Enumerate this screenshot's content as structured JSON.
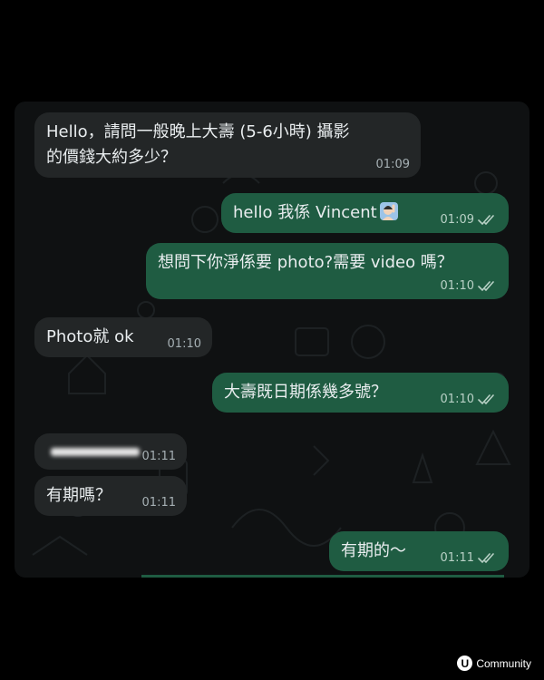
{
  "messages": [
    {
      "text": "Hello，請問一般晚上大壽 (5-6小時) 攝影\n的價錢大約多少？",
      "time": "01:09"
    },
    {
      "text": "hello 我係 Vincent",
      "time": "01:09",
      "emoji": "person-raising-hand-emoji"
    },
    {
      "text": "想問下你淨係要 photo?需要 video 嗎？",
      "time": "01:10"
    },
    {
      "text": "Photo就 ok",
      "time": "01:10"
    },
    {
      "text": "大壽既日期係幾多號？",
      "time": "01:10"
    },
    {
      "text": "",
      "time": "01:11"
    },
    {
      "text": "有期嗎？",
      "time": "01:11"
    },
    {
      "text": "有期的～",
      "time": "01:11"
    }
  ],
  "brand": {
    "logo_letter": "U",
    "name": "Community"
  },
  "icons": {
    "read_receipt": "double-check-icon"
  },
  "colors": {
    "incoming": "#232627",
    "outgoing": "#1f5c42",
    "background": "#0f1112"
  }
}
